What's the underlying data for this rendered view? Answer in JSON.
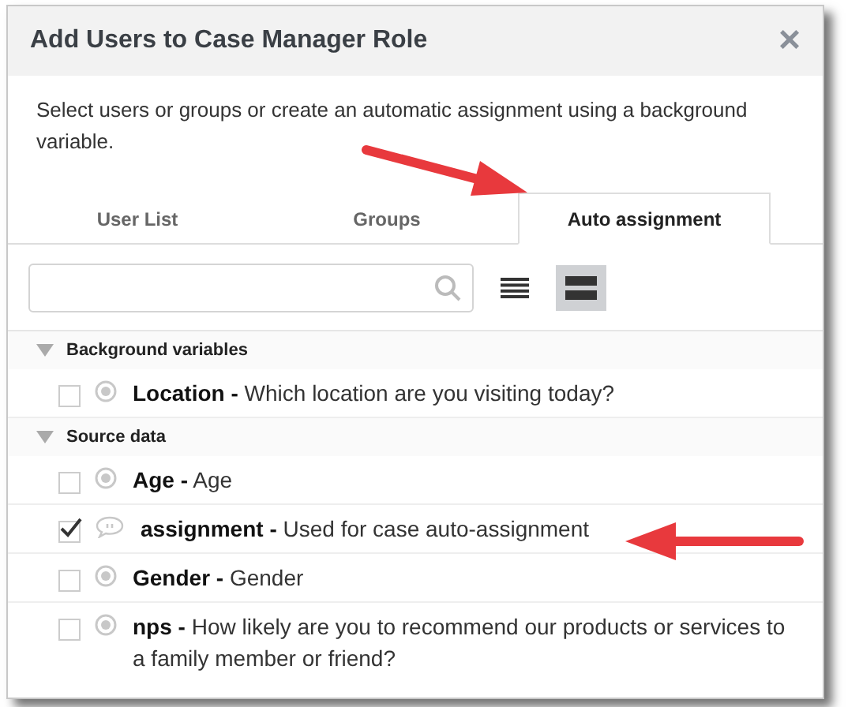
{
  "dialog": {
    "title": "Add Users to Case Manager Role",
    "close": "×",
    "description": "Select users or groups or create an automatic assignment using a background variable."
  },
  "tabs": [
    {
      "label": "User List",
      "selected": false
    },
    {
      "label": "Groups",
      "selected": false
    },
    {
      "label": "Auto assignment",
      "selected": true
    }
  ],
  "view_toggle": [
    {
      "kind": "list",
      "selected": false
    },
    {
      "kind": "rows",
      "selected": true
    }
  ],
  "groups": [
    {
      "label": "Background variables",
      "expanded": true,
      "items": [
        {
          "name": "Location -",
          "description": "Which location are you visiting today?",
          "kind": "radio",
          "checked": false
        }
      ]
    },
    {
      "label": "Source data",
      "expanded": true,
      "items": [
        {
          "name": "Age -",
          "description": "Age",
          "kind": "radio",
          "checked": false
        },
        {
          "name": "assignment -",
          "description": "Used for case auto-assignment",
          "kind": "comment",
          "checked": true
        },
        {
          "name": "Gender -",
          "description": "Gender",
          "kind": "radio",
          "checked": false
        },
        {
          "name": "nps -",
          "description": "How likely are you to recommend our products or services to a family member or friend?",
          "kind": "radio",
          "checked": false
        }
      ]
    }
  ]
}
